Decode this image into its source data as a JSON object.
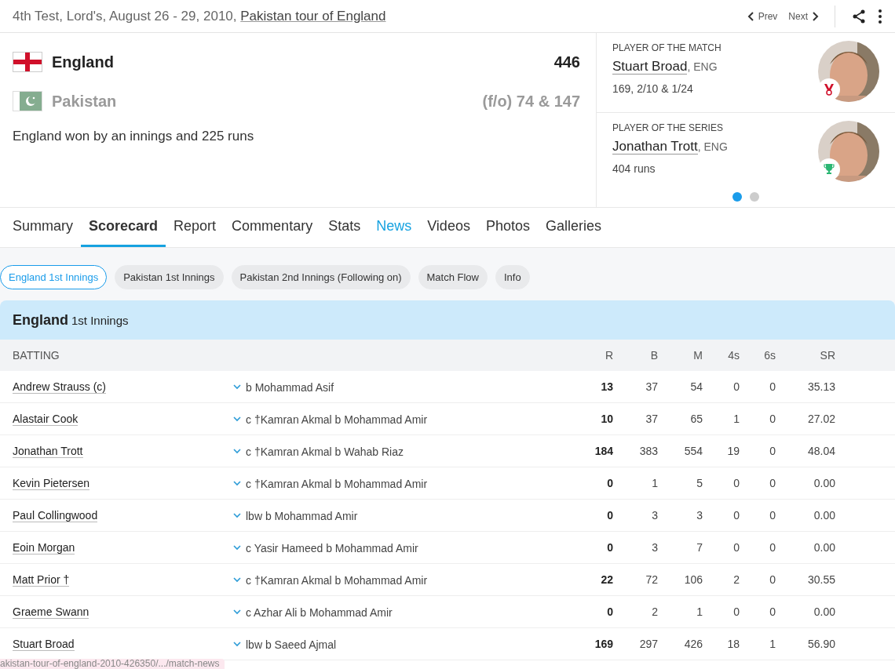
{
  "header": {
    "match_info": "4th Test, Lord's, August 26 - 29, 2010, ",
    "series_link": "Pakistan tour of England",
    "prev": "Prev",
    "next": "Next"
  },
  "teams": [
    {
      "kind": "england",
      "name": "England",
      "score": "446",
      "winner": true
    },
    {
      "kind": "pakistan",
      "name": "Pakistan",
      "score": "(f/o) 74 & 147",
      "winner": false
    }
  ],
  "result": "England won by an innings and 225 runs",
  "awards": [
    {
      "label": "PLAYER OF THE MATCH",
      "player": "Stuart Broad",
      "team": ", ENG",
      "stats": "169, 2/10 & 1/24",
      "kind": "medal"
    },
    {
      "label": "PLAYER OF THE SERIES",
      "player": "Jonathan Trott",
      "team": ", ENG",
      "stats": "404 runs",
      "kind": "trophy"
    }
  ],
  "carousel": [
    {
      "selected": true
    },
    {
      "selected": false
    }
  ],
  "tabs": [
    {
      "label": "Summary",
      "selected": false,
      "highlighted": false
    },
    {
      "label": "Scorecard",
      "selected": true,
      "highlighted": false
    },
    {
      "label": "Report",
      "selected": false,
      "highlighted": false
    },
    {
      "label": "Commentary",
      "selected": false,
      "highlighted": false
    },
    {
      "label": "Stats",
      "selected": false,
      "highlighted": false
    },
    {
      "label": "News",
      "selected": false,
      "highlighted": true
    },
    {
      "label": "Videos",
      "selected": false,
      "highlighted": false
    },
    {
      "label": "Photos",
      "selected": false,
      "highlighted": false
    },
    {
      "label": "Galleries",
      "selected": false,
      "highlighted": false
    }
  ],
  "innings_tabs": [
    {
      "label": "England 1st Innings",
      "selected": true
    },
    {
      "label": "Pakistan 1st Innings",
      "selected": false
    },
    {
      "label": "Pakistan 2nd Innings (Following on)",
      "selected": false
    },
    {
      "label": "Match Flow",
      "selected": false
    },
    {
      "label": "Info",
      "selected": false
    }
  ],
  "scorecard": {
    "team": "England",
    "innings": "1st Innings",
    "columns": [
      "BATTING",
      "R",
      "B",
      "M",
      "4s",
      "6s",
      "SR"
    ],
    "rows": [
      {
        "batter": "Andrew Strauss (c)",
        "dismissal": "b Mohammad Asif",
        "r": "13",
        "b": "37",
        "m": "54",
        "fours": "0",
        "sixes": "0",
        "sr": "35.13"
      },
      {
        "batter": "Alastair Cook",
        "dismissal": "c †Kamran Akmal b Mohammad Amir",
        "r": "10",
        "b": "37",
        "m": "65",
        "fours": "1",
        "sixes": "0",
        "sr": "27.02"
      },
      {
        "batter": "Jonathan Trott",
        "dismissal": "c †Kamran Akmal b Wahab Riaz",
        "r": "184",
        "b": "383",
        "m": "554",
        "fours": "19",
        "sixes": "0",
        "sr": "48.04"
      },
      {
        "batter": "Kevin Pietersen",
        "dismissal": "c †Kamran Akmal b Mohammad Amir",
        "r": "0",
        "b": "1",
        "m": "5",
        "fours": "0",
        "sixes": "0",
        "sr": "0.00"
      },
      {
        "batter": "Paul Collingwood",
        "dismissal": "lbw b Mohammad Amir",
        "r": "0",
        "b": "3",
        "m": "3",
        "fours": "0",
        "sixes": "0",
        "sr": "0.00"
      },
      {
        "batter": "Eoin Morgan",
        "dismissal": "c Yasir Hameed b Mohammad Amir",
        "r": "0",
        "b": "3",
        "m": "7",
        "fours": "0",
        "sixes": "0",
        "sr": "0.00"
      },
      {
        "batter": "Matt Prior †",
        "dismissal": "c †Kamran Akmal b Mohammad Amir",
        "r": "22",
        "b": "72",
        "m": "106",
        "fours": "2",
        "sixes": "0",
        "sr": "30.55"
      },
      {
        "batter": "Graeme Swann",
        "dismissal": "c Azhar Ali b Mohammad Amir",
        "r": "0",
        "b": "2",
        "m": "1",
        "fours": "0",
        "sixes": "0",
        "sr": "0.00"
      },
      {
        "batter": "Stuart Broad",
        "dismissal": "lbw b Saeed Ajmal",
        "r": "169",
        "b": "297",
        "m": "426",
        "fours": "18",
        "sixes": "1",
        "sr": "56.90"
      }
    ]
  },
  "status_bar": {
    "url": "akistan-tour-of-england-2010-426350/.../match-news"
  }
}
